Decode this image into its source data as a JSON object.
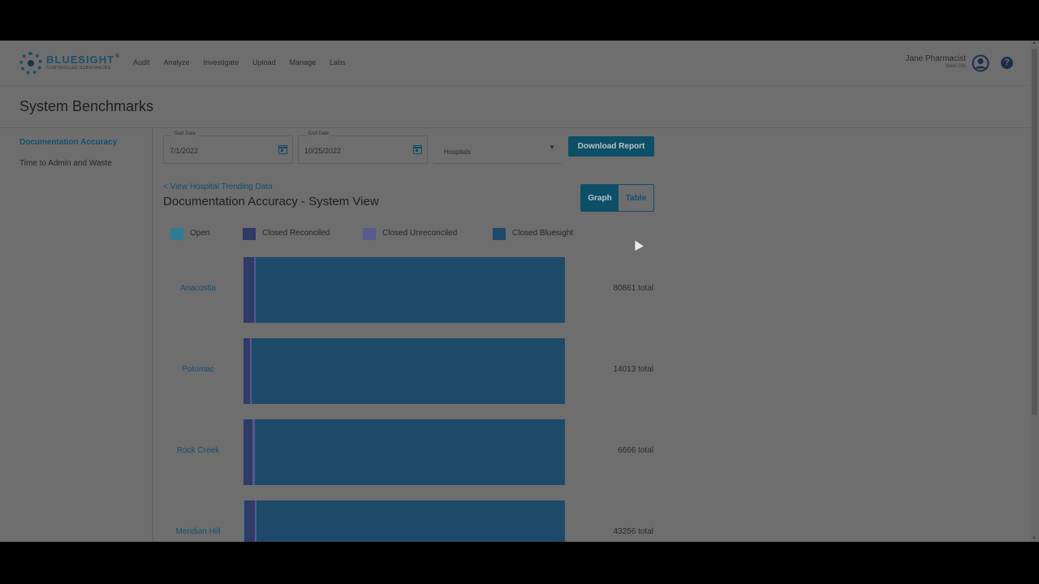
{
  "header": {
    "logo_main": "BLUESIGHT",
    "logo_reg": "®",
    "logo_sub": "CONTROLLED SUBSTANCES",
    "nav": [
      "Audit",
      "Analyze",
      "Investigate",
      "Upload",
      "Manage",
      "Labs"
    ],
    "user_name": "Jane Pharmacist",
    "user_location": "Steel City",
    "help": "?"
  },
  "page": {
    "title": "System Benchmarks"
  },
  "sidebar": {
    "items": [
      {
        "label": "Documentation Accuracy",
        "active": true
      },
      {
        "label": "Time to Admin and Waste",
        "active": false
      }
    ]
  },
  "filters": {
    "start_label": "Start Date",
    "start_value": "7/1/2022",
    "end_label": "End Date",
    "end_value": "10/25/2022",
    "hospitals_placeholder": "Hospitals",
    "download_label": "Download Report"
  },
  "section": {
    "back_link": "< View Hospital Trending Data",
    "title": "Documentation Accuracy - System View",
    "toggle": {
      "graph": "Graph",
      "table": "Table"
    }
  },
  "colors": {
    "open": "#2f7b93",
    "closed_reconciled": "#2e3b66",
    "closed_unreconciled": "#565a8e",
    "closed_bluesight": "#1e4a6a"
  },
  "chart_data": {
    "type": "bar",
    "orientation": "horizontal-stacked-percent",
    "categories": [
      "Anacostia",
      "Potomac",
      "Rock Creek",
      "Meridian Hill"
    ],
    "series": [
      {
        "name": "Open",
        "values": [
          0,
          0,
          0,
          0.3
        ]
      },
      {
        "name": "Closed Reconciled",
        "values": [
          3.2,
          2.1,
          2.8,
          3.3
        ]
      },
      {
        "name": "Closed Unreconciled",
        "values": [
          0.6,
          0.4,
          0.7,
          0.5
        ]
      },
      {
        "name": "Closed Bluesight",
        "values": [
          96.2,
          97.5,
          96.5,
          95.9
        ]
      }
    ],
    "totals": [
      "80861 total",
      "14013 total",
      "6666 total",
      "43256 total"
    ],
    "legend": "top"
  }
}
